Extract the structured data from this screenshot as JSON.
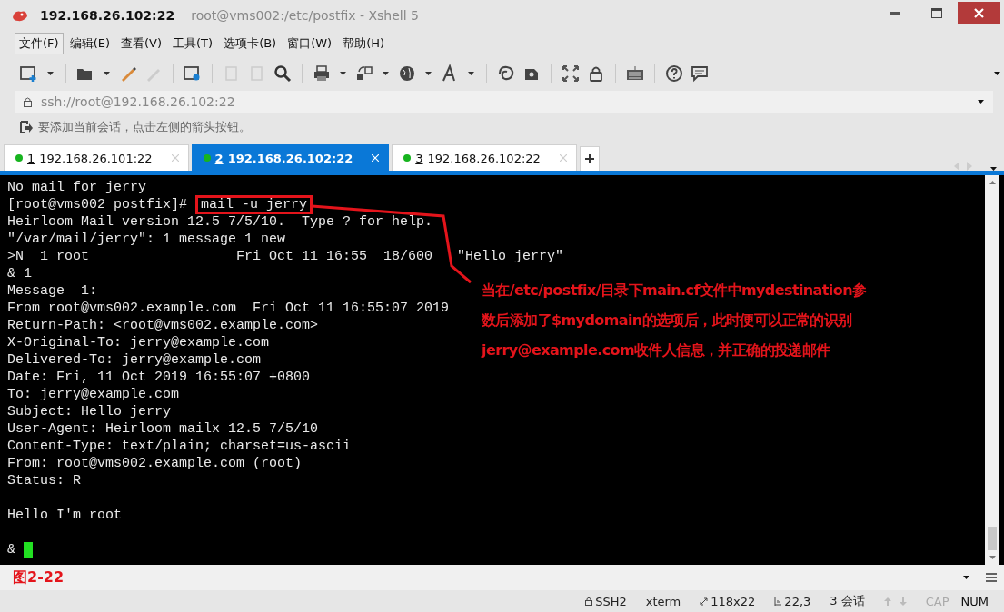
{
  "window": {
    "host": "192.168.26.102:22",
    "title": "root@vms002:/etc/postfix - Xshell 5"
  },
  "menu": [
    {
      "label": "文件(F)",
      "selected": true
    },
    {
      "label": "编辑(E)",
      "selected": false
    },
    {
      "label": "查看(V)",
      "selected": false
    },
    {
      "label": "工具(T)",
      "selected": false
    },
    {
      "label": "选项卡(B)",
      "selected": false
    },
    {
      "label": "窗口(W)",
      "selected": false
    },
    {
      "label": "帮助(H)",
      "selected": false
    }
  ],
  "address": {
    "value": "ssh://root@192.168.26.102:22"
  },
  "hint": "要添加当前会话，点击左侧的箭头按钮。",
  "tabs": [
    {
      "number": "1",
      "label": "192.168.26.101:22",
      "selected": false
    },
    {
      "number": "2",
      "label": "192.168.26.102:22",
      "selected": true
    },
    {
      "number": "3",
      "label": "192.168.26.102:22",
      "selected": false
    }
  ],
  "terminal": {
    "lines": [
      {
        "kind": "text",
        "text": "No mail for jerry"
      },
      {
        "kind": "command",
        "prompt": "[root@vms002 postfix]#",
        "command": "mail -u jerry",
        "highlighted": true
      },
      {
        "kind": "text",
        "text": "Heirloom Mail version 12.5 7/5/10.  Type ? for help."
      },
      {
        "kind": "text",
        "text": "\"/var/mail/jerry\": 1 message 1 new"
      },
      {
        "kind": "text",
        "text": ">N  1 root                  Fri Oct 11 16:55  18/600   \"Hello jerry\""
      },
      {
        "kind": "text",
        "text": "& 1"
      },
      {
        "kind": "text",
        "text": "Message  1:"
      },
      {
        "kind": "text",
        "text": "From root@vms002.example.com  Fri Oct 11 16:55:07 2019"
      },
      {
        "kind": "text",
        "text": "Return-Path: <root@vms002.example.com>"
      },
      {
        "kind": "text",
        "text": "X-Original-To: jerry@example.com"
      },
      {
        "kind": "text",
        "text": "Delivered-To: jerry@example.com"
      },
      {
        "kind": "text",
        "text": "Date: Fri, 11 Oct 2019 16:55:07 +0800"
      },
      {
        "kind": "text",
        "text": "To: jerry@example.com"
      },
      {
        "kind": "text",
        "text": "Subject: Hello jerry"
      },
      {
        "kind": "text",
        "text": "User-Agent: Heirloom mailx 12.5 7/5/10"
      },
      {
        "kind": "text",
        "text": "Content-Type: text/plain; charset=us-ascii"
      },
      {
        "kind": "text",
        "text": "From: root@vms002.example.com (root)"
      },
      {
        "kind": "text",
        "text": "Status: R"
      },
      {
        "kind": "blank"
      },
      {
        "kind": "text",
        "text": "Hello I'm root"
      },
      {
        "kind": "blank"
      },
      {
        "kind": "input",
        "text": "&"
      }
    ]
  },
  "annotation": {
    "lines": [
      "当在/etc/postfix/目录下main.cf文件中mydestination参",
      "数后添加了$mydomain的选项后，此时便可以正常的识别",
      "jerry@example.com收件人信息，并正确的投递邮件"
    ]
  },
  "figure_label": "图2-22",
  "status_bar": {
    "protocol": "SSH2",
    "terminal_type": "xterm",
    "size": "118x22",
    "cursor": "22,3",
    "sessions": "3 会话",
    "caps": {
      "label": "CAP",
      "on": false
    },
    "num": {
      "label": "NUM",
      "on": true
    }
  }
}
